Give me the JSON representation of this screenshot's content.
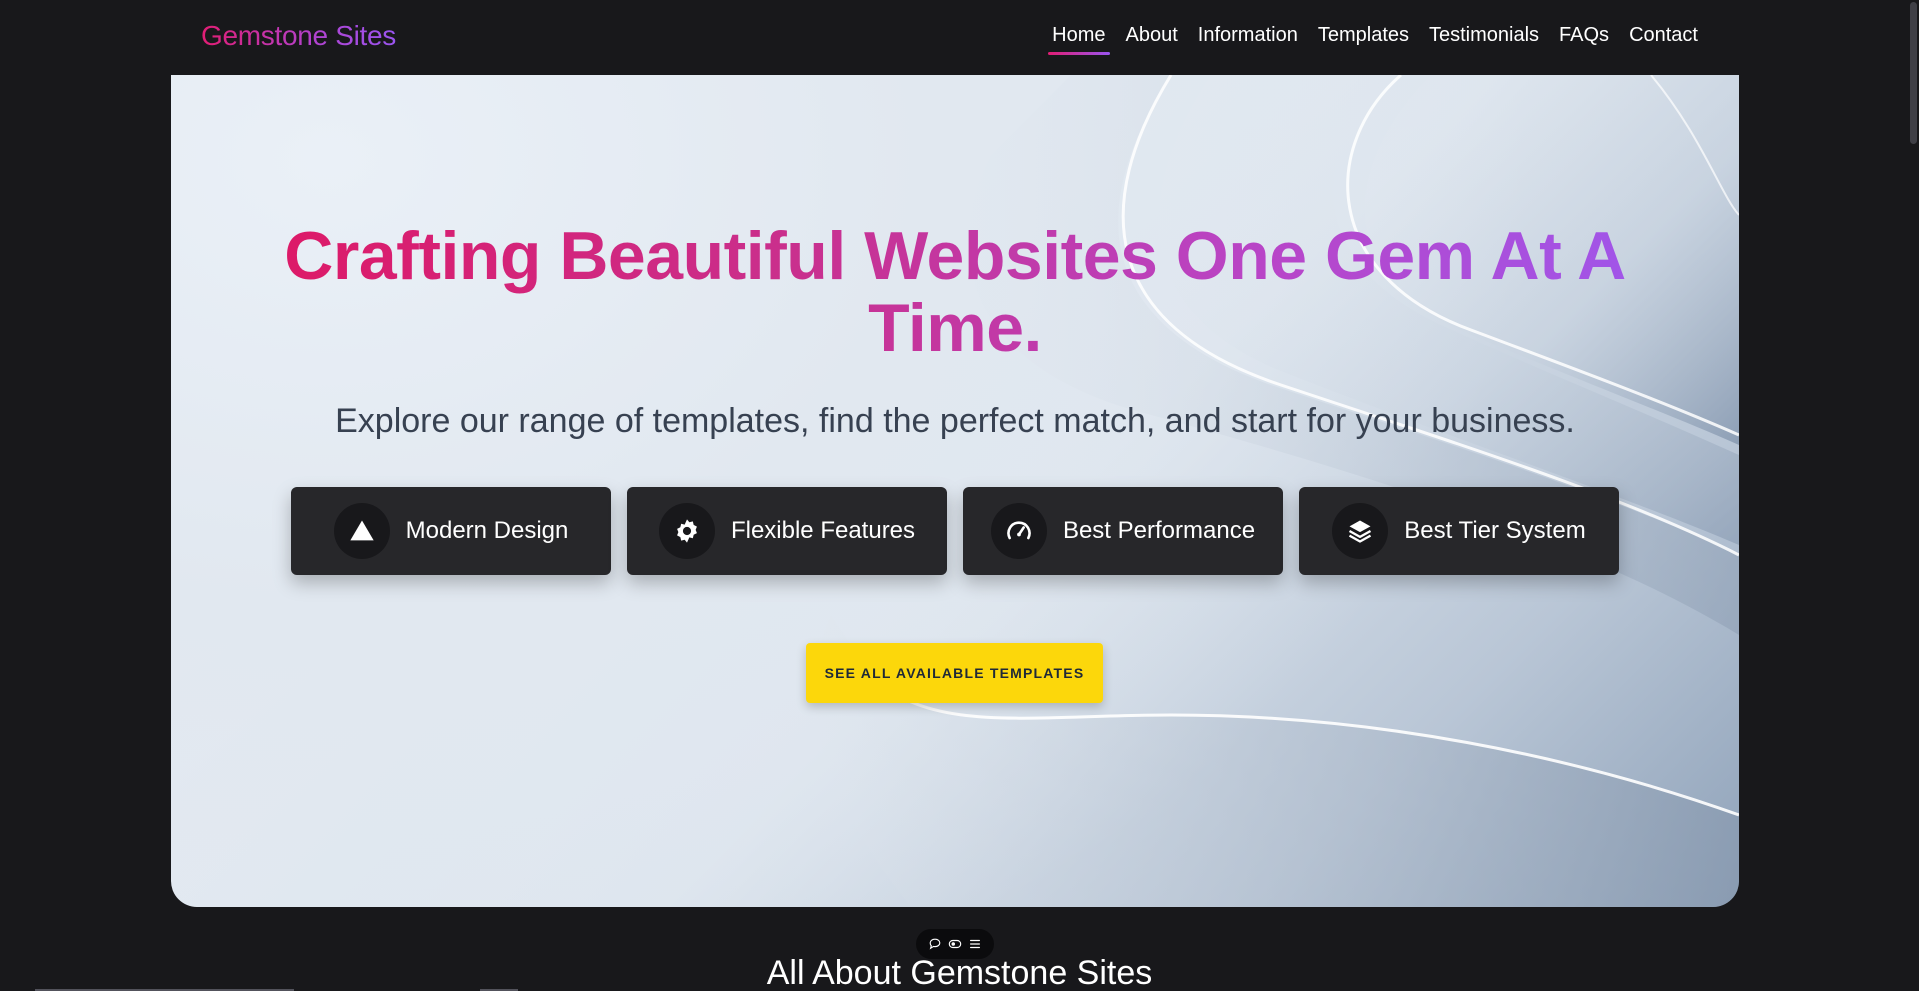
{
  "brand": "Gemstone Sites",
  "nav": [
    {
      "label": "Home",
      "active": true
    },
    {
      "label": "About"
    },
    {
      "label": "Information"
    },
    {
      "label": "Templates"
    },
    {
      "label": "Testimonials"
    },
    {
      "label": "FAQs"
    },
    {
      "label": "Contact"
    }
  ],
  "hero": {
    "title": "Crafting Beautiful Websites One Gem At A Time.",
    "subtitle": "Explore our range of templates, find the perfect match, and start for your business.",
    "features": [
      {
        "label": "Modern Design",
        "icon": "triangle-icon"
      },
      {
        "label": "Flexible Features",
        "icon": "gear-icon"
      },
      {
        "label": "Best Performance",
        "icon": "speedometer-icon"
      },
      {
        "label": "Best Tier System",
        "icon": "layers-icon"
      }
    ],
    "cta": "SEE ALL AVAILABLE TEMPLATES"
  },
  "section_title": "All About Gemstone Sites",
  "toolbar_icons": [
    "chat-icon",
    "toggle-icon",
    "menu-icon"
  ],
  "colors": {
    "background": "#18181b",
    "card": "#27272a",
    "cta": "#fcd70b",
    "gradient_start": "#e11560",
    "gradient_end": "#9a5af2"
  }
}
